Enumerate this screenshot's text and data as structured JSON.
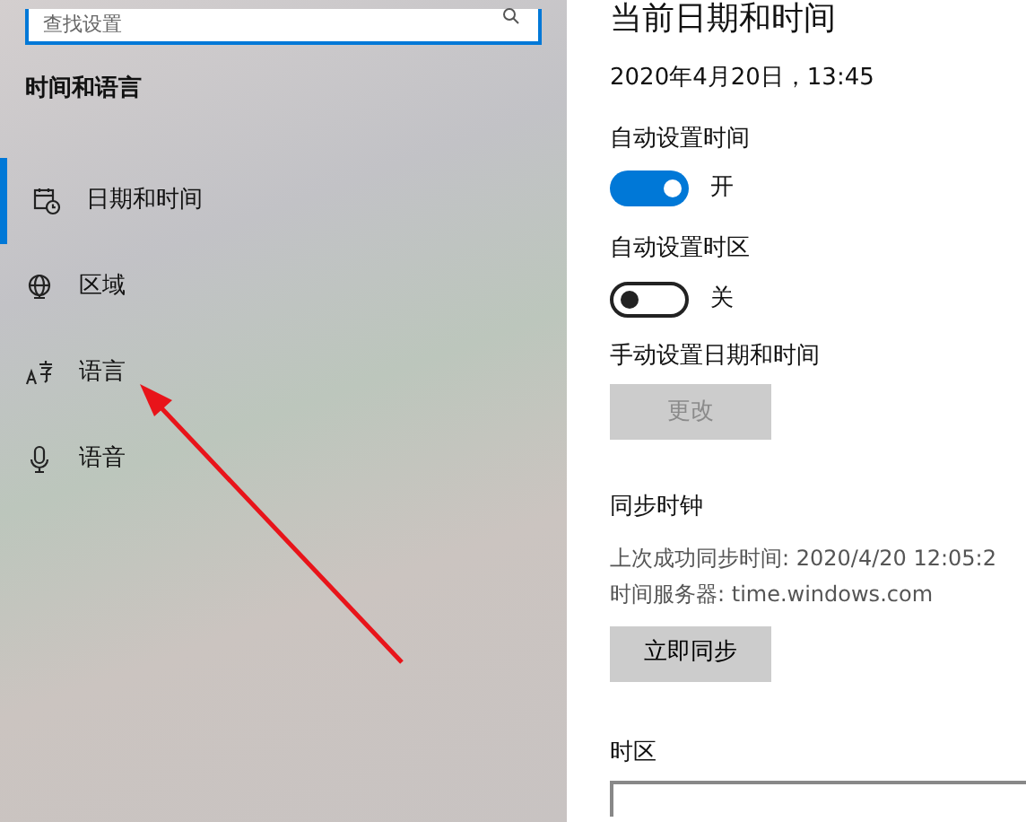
{
  "sidebar": {
    "search": {
      "placeholder": "查找设置"
    },
    "title": "时间和语言",
    "items": [
      {
        "label": "日期和时间",
        "kind": "calendar",
        "selected": true
      },
      {
        "label": "区域",
        "kind": "globe",
        "selected": false
      },
      {
        "label": "语言",
        "kind": "language",
        "selected": false
      },
      {
        "label": "语音",
        "kind": "mic",
        "selected": false
      }
    ]
  },
  "main": {
    "title": "当前日期和时间",
    "current": "2020年4月20日，13:45",
    "toggles": [
      {
        "label": "自动设置时间",
        "on": true,
        "state_text": "开"
      },
      {
        "label": "自动设置时区",
        "on": false,
        "state_text": "关"
      }
    ],
    "manual": {
      "label": "手动设置日期和时间",
      "button": "更改",
      "disabled": true
    },
    "sync": {
      "title": "同步时钟",
      "lines": [
        "上次成功同步时间: 2020/4/20 12:05:2",
        "时间服务器: time.windows.com"
      ],
      "button": "立即同步"
    },
    "timezone": {
      "label": "时区"
    }
  }
}
